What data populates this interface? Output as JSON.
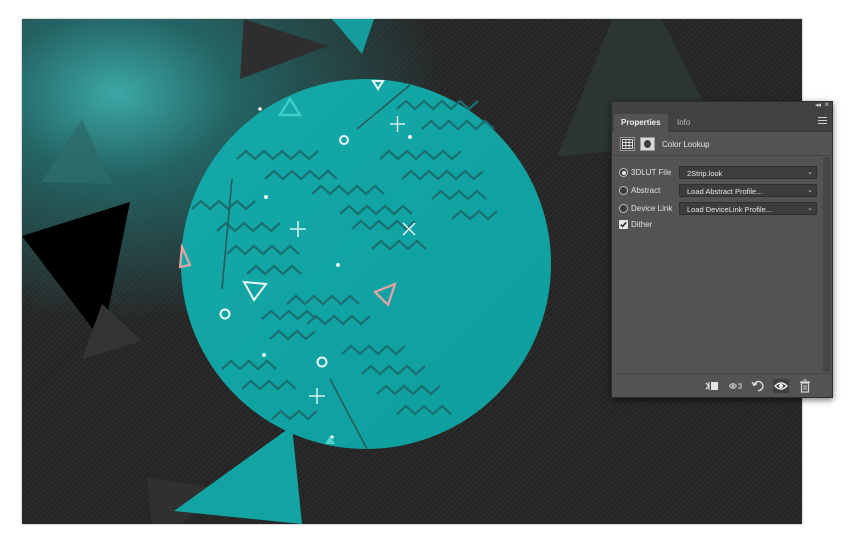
{
  "panel": {
    "tabs": [
      {
        "label": "Properties",
        "active": true
      },
      {
        "label": "Info",
        "active": false
      }
    ],
    "adjustment_title": "Color Lookup",
    "options": [
      {
        "label": "3DLUT File",
        "value": "2Strip.look",
        "selected": true
      },
      {
        "label": "Abstract",
        "value": "Load Abstract Profile...",
        "selected": false
      },
      {
        "label": "Device Link",
        "value": "Load DeviceLink Profile...",
        "selected": false
      }
    ],
    "dither": {
      "label": "Dither",
      "checked": true
    },
    "footer_icons": [
      "clip-to-layer-icon",
      "view-previous-state-icon",
      "reset-icon",
      "toggle-visibility-icon",
      "delete-icon"
    ]
  },
  "colors": {
    "canvas_dark": "#262626",
    "teal": "#0fa5a5",
    "teal_glow": "#3aadab",
    "zigzag": "#1d6e6e",
    "pink": "#e8a3a3",
    "panel_bg": "#535353",
    "panel_header": "#424242"
  }
}
